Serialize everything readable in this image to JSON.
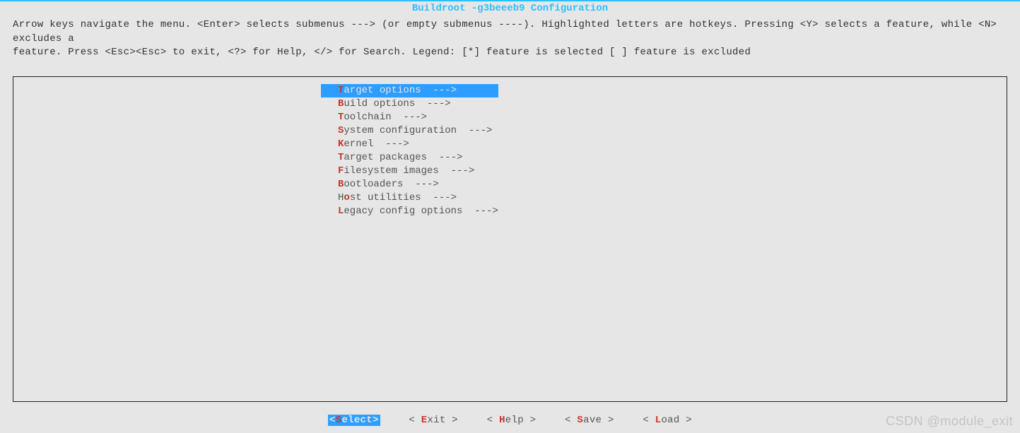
{
  "title": "Buildroot -g3beeeb9 Configuration",
  "help": {
    "line1": "Arrow keys navigate the menu.  <Enter> selects submenus ---> (or empty submenus ----).  Highlighted letters are hotkeys.  Pressing <Y> selects a feature, while <N> excludes a",
    "line2": "feature.  Press <Esc><Esc> to exit, <?> for Help, </> for Search.  Legend: [*] feature is selected  [ ] feature is excluded"
  },
  "menu": {
    "items": [
      {
        "hotkey": "T",
        "rest": "arget options  --->",
        "selected": true
      },
      {
        "hotkey": "B",
        "rest": "uild options  --->",
        "selected": false
      },
      {
        "hotkey": "T",
        "rest": "oolchain  --->",
        "selected": false
      },
      {
        "hotkey": "S",
        "rest": "ystem configuration  --->",
        "selected": false
      },
      {
        "hotkey": "K",
        "rest": "ernel  --->",
        "selected": false
      },
      {
        "hotkey": "T",
        "rest": "arget packages  --->",
        "selected": false
      },
      {
        "hotkey": "F",
        "rest": "ilesystem images  --->",
        "selected": false
      },
      {
        "hotkey": "B",
        "rest": "ootloaders  --->",
        "selected": false
      },
      {
        "hotkey": "o",
        "pre": "H",
        "rest": "st utilities  --->",
        "selected": false
      },
      {
        "hotkey": "L",
        "rest": "egacy config options  --->",
        "selected": false
      }
    ]
  },
  "footer": {
    "select": {
      "left": "<",
      "hotkey": "S",
      "rest": "elect",
      "right": ">",
      "active": true
    },
    "exit": {
      "left": "< ",
      "hotkey": "E",
      "rest": "xit ",
      "right": ">"
    },
    "help": {
      "left": "< ",
      "hotkey": "H",
      "rest": "elp ",
      "right": ">"
    },
    "save": {
      "left": "< ",
      "hotkey": "S",
      "rest": "ave ",
      "right": ">"
    },
    "load": {
      "left": "< ",
      "hotkey": "L",
      "rest": "oad ",
      "right": ">"
    }
  },
  "watermark": "CSDN @module_exit"
}
